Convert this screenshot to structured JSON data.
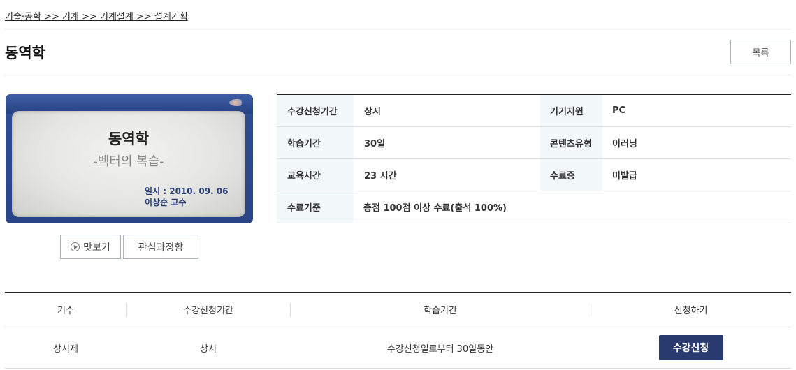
{
  "breadcrumb": {
    "text": "기술·공학 >> 기계 >> 기계설계 >> 설계기획"
  },
  "page": {
    "title": "동역학",
    "list_button": "목록"
  },
  "thumbnail": {
    "slide_title": "동역학",
    "slide_subtitle": "-벡터의 복습-",
    "slide_date": "일시 : 2010. 09. 06",
    "slide_professor": "이상순 교수"
  },
  "actions": {
    "preview_label": "맛보기",
    "interest_label": "관심과정함"
  },
  "info": {
    "rows": [
      {
        "label1": "수강신청기간",
        "value1": "상시",
        "label2": "기기지원",
        "value2": "PC"
      },
      {
        "label1": "학습기간",
        "value1": "30일",
        "label2": "콘텐츠유형",
        "value2": "이러닝"
      },
      {
        "label1": "교육시간",
        "value1": "23 시간",
        "label2": "수료증",
        "value2": "미발급"
      },
      {
        "label1": "수료기준",
        "value1": "총점 100점 이상 수료(출석 100%)"
      }
    ]
  },
  "course_table": {
    "headers": [
      "기수",
      "수강신청기간",
      "학습기간",
      "신청하기"
    ],
    "row": {
      "term": "상시제",
      "period": "상시",
      "study": "수강신청일로부터 30일동안",
      "apply_label": "수강신청"
    }
  }
}
